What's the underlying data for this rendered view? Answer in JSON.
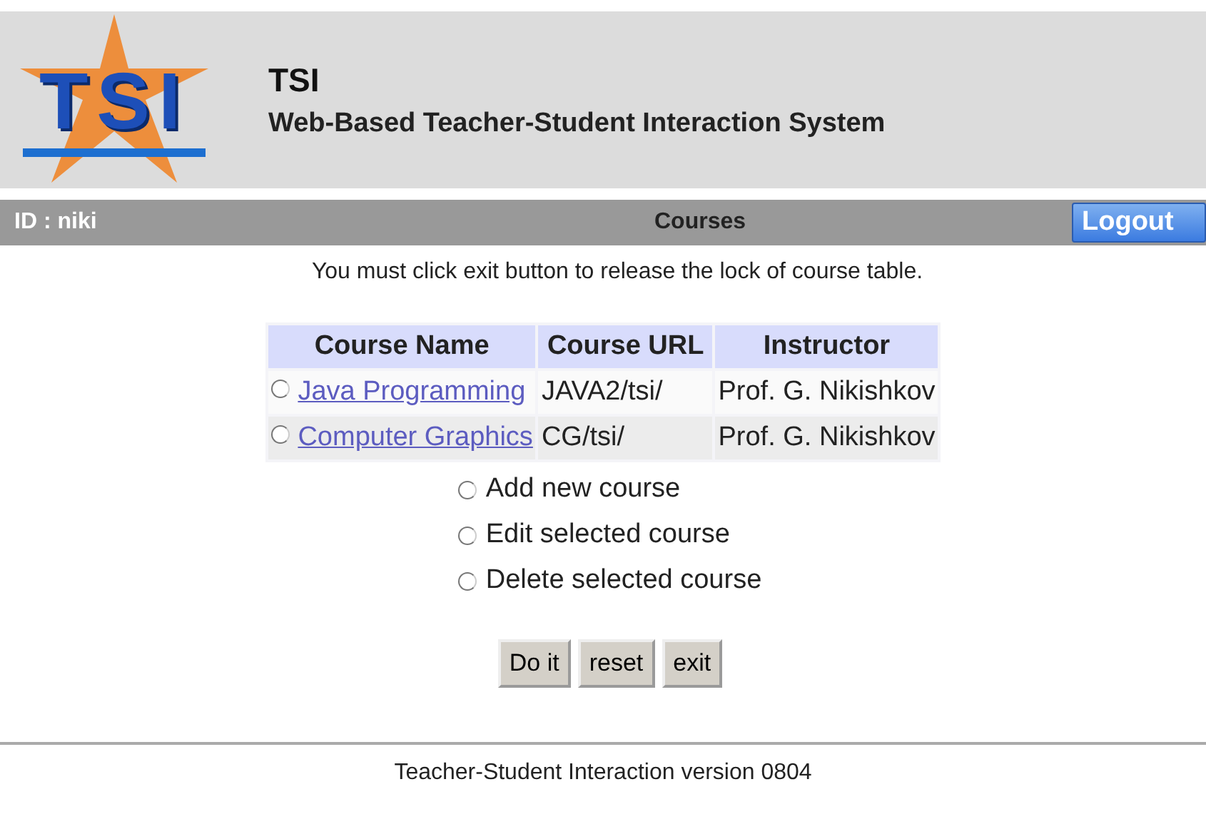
{
  "header": {
    "logo_text": "TSI",
    "title": "TSI",
    "subtitle": "Web-Based Teacher-Student Interaction System"
  },
  "nav_bar": {
    "user": "ID : niki",
    "page_title": "Courses",
    "logout": "Logout"
  },
  "notice": "You must click exit button to release the lock of course table.",
  "table": {
    "columns": [
      "Course Name",
      "Course URL",
      "Instructor"
    ],
    "rows": [
      {
        "name": "Java Programming",
        "url": "JAVA2/tsi/",
        "instructor": "Prof. G. Nikishkov",
        "selected": false
      },
      {
        "name": "Computer Graphics",
        "url": "CG/tsi/",
        "instructor": "Prof. G. Nikishkov",
        "selected": false
      }
    ]
  },
  "actions": [
    {
      "label": "Add new course",
      "selected": false
    },
    {
      "label": "Edit selected course",
      "selected": false
    },
    {
      "label": "Delete selected course",
      "selected": false
    }
  ],
  "buttons": [
    "Do it",
    "reset",
    "exit"
  ],
  "footer": "Teacher-Student Interaction version 0804"
}
